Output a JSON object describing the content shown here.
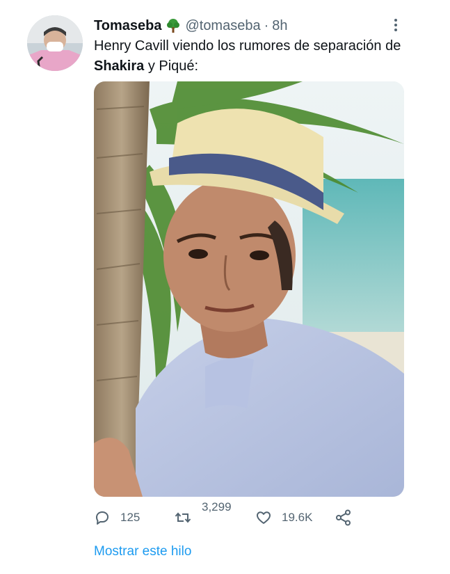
{
  "tweet": {
    "display_name": "Tomaseba",
    "name_emoji_icon": "tree-icon",
    "handle": "@tomaseba",
    "separator": "·",
    "time": "8h",
    "text_part1": "Henry Cavill viendo los rumores de separación de ",
    "text_bold": "Shakira",
    "text_part2": " y Piqué:",
    "media_icon": "photo-man-hat-palm-beach",
    "more_icon": "more-vertical-icon"
  },
  "actions": {
    "reply_count": "125",
    "retweet_count": "3,299",
    "like_count": "19.6K"
  },
  "show_thread_label": "Mostrar este hilo",
  "colors": {
    "secondary_text": "#536471",
    "link": "#1d9bf0",
    "primary_text": "#0f1419"
  }
}
